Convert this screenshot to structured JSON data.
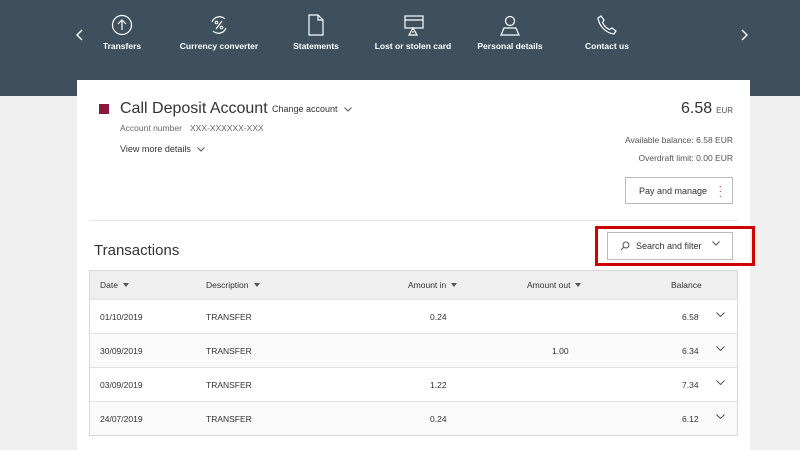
{
  "nav": {
    "items": [
      {
        "label": "Transfers",
        "icon": "transfer-icon"
      },
      {
        "label": "Currency converter",
        "icon": "currency-icon"
      },
      {
        "label": "Statements",
        "icon": "document-icon"
      },
      {
        "label": "Lost or stolen card",
        "icon": "card-icon"
      },
      {
        "label": "Personal details",
        "icon": "person-icon"
      },
      {
        "label": "Contact us",
        "icon": "phone-icon"
      }
    ]
  },
  "account": {
    "name": "Call Deposit Account",
    "change_label": "Change account",
    "number_label": "Account number",
    "number_value": "XXX-XXXXXX-XXX",
    "view_more": "View more details",
    "balance": "6.58",
    "currency": "EUR",
    "available": "Available balance: 6.58 EUR",
    "overdraft": "Overdraft limit: 0.00 EUR",
    "pay_button": "Pay and manage",
    "marker_color": "#8b1a3a"
  },
  "transactions": {
    "title": "Transactions",
    "search_label": "Search and filter",
    "headers": {
      "date": "Date",
      "description": "Description",
      "amount_in": "Amount in",
      "amount_out": "Amount out",
      "balance": "Balance"
    },
    "rows": [
      {
        "date": "01/10/2019",
        "description": "TRANSFER",
        "amount_in": "0.24",
        "amount_out": "",
        "balance": "6.58"
      },
      {
        "date": "30/09/2019",
        "description": "TRANSFER",
        "amount_in": "",
        "amount_out": "1.00",
        "balance": "6.34"
      },
      {
        "date": "03/09/2019",
        "description": "TRANSFER",
        "amount_in": "1.22",
        "amount_out": "",
        "balance": "7.34"
      },
      {
        "date": "24/07/2019",
        "description": "TRANSFER",
        "amount_in": "0.24",
        "amount_out": "",
        "balance": "6.12"
      }
    ]
  },
  "colors": {
    "nav_bg": "#3e505d",
    "highlight": "#d00000",
    "accent_red": "#d2232a"
  }
}
